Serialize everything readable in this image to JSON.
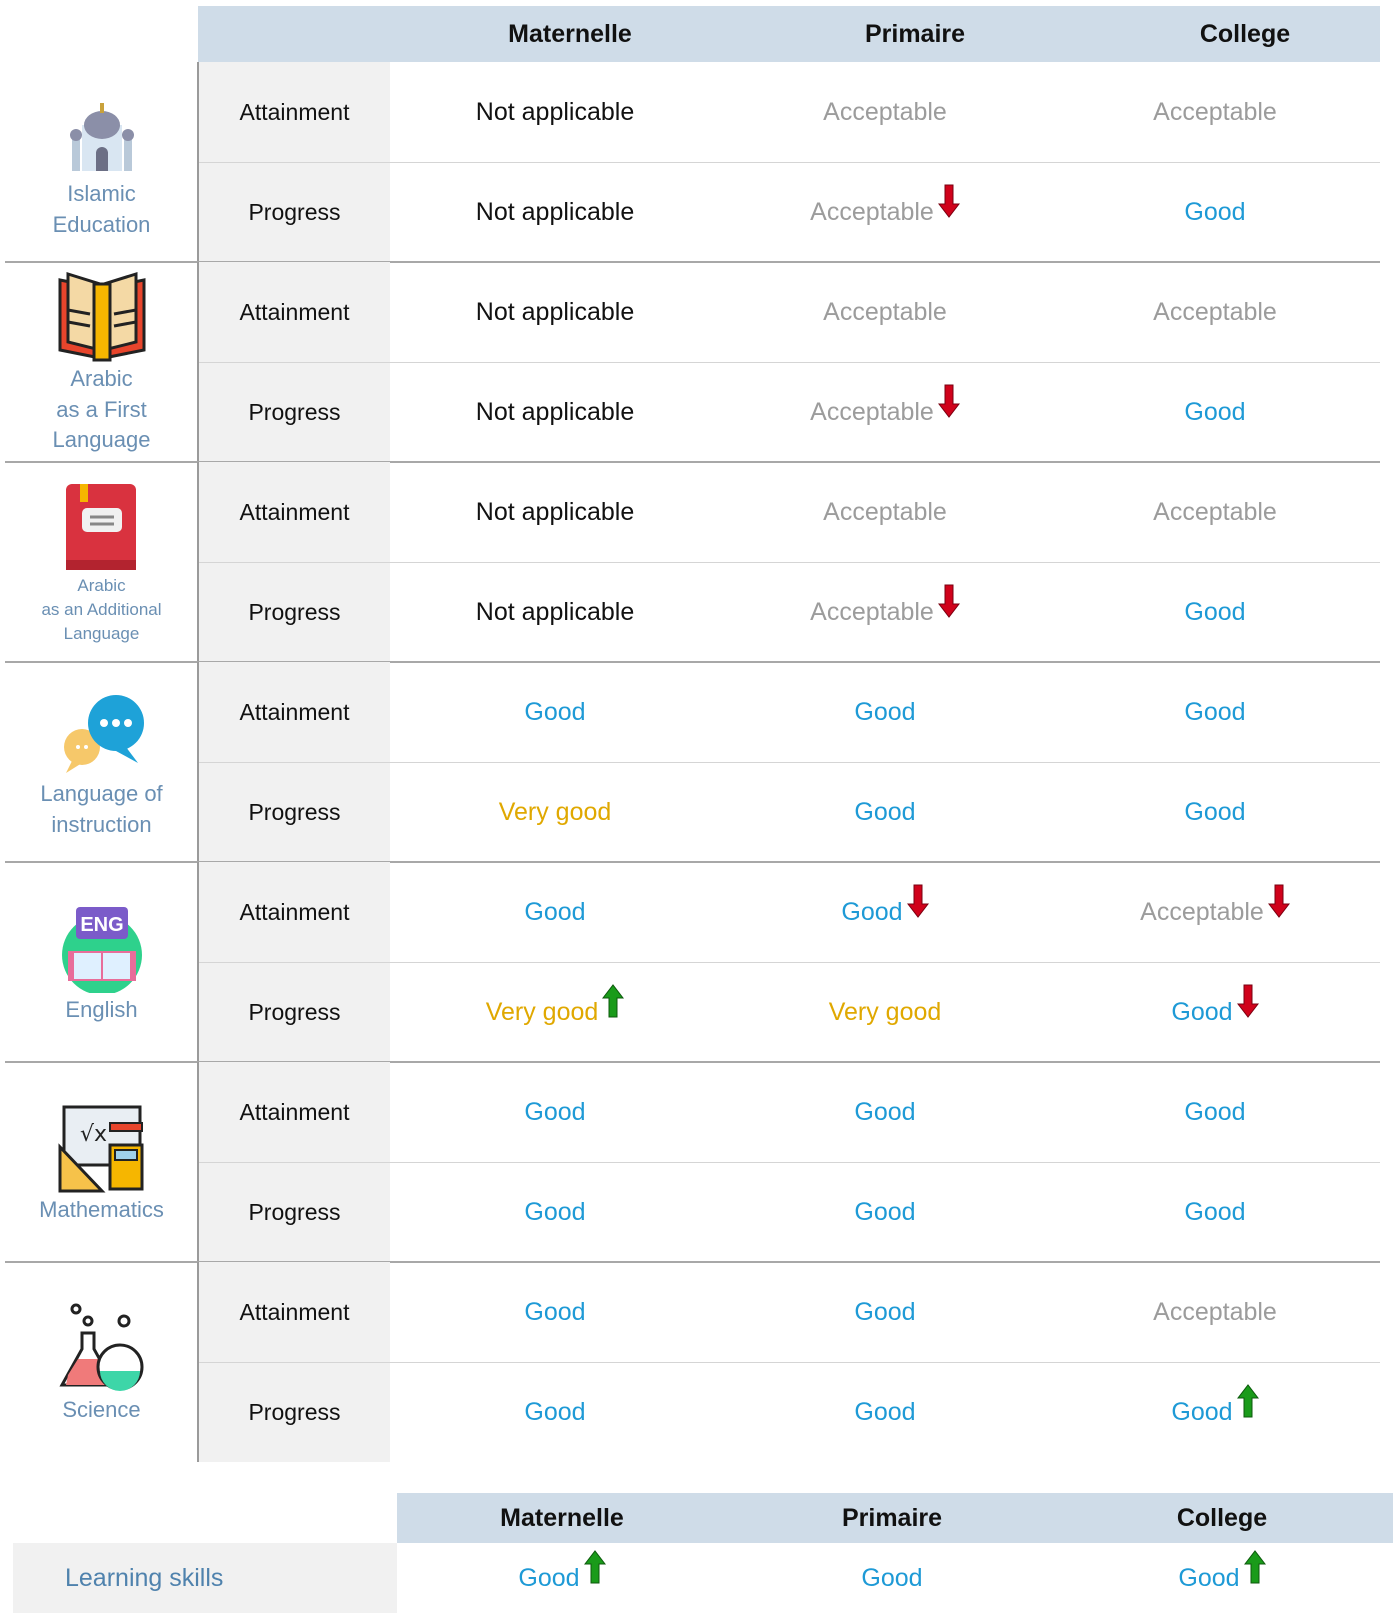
{
  "table1": {
    "headers": [
      "",
      "Maternelle",
      "Primaire",
      "College"
    ],
    "subjects": [
      {
        "name_lines": [
          "Islamic",
          "Education"
        ],
        "icon": "mosque-icon",
        "rows": [
          {
            "type": "Attainment",
            "cells": [
              {
                "text": "Not applicable",
                "status": "na"
              },
              {
                "text": "Acceptable",
                "status": "acc"
              },
              {
                "text": "Acceptable",
                "status": "acc"
              }
            ]
          },
          {
            "type": "Progress",
            "cells": [
              {
                "text": "Not applicable",
                "status": "na"
              },
              {
                "text": "Acceptable",
                "status": "acc",
                "trend": "down"
              },
              {
                "text": "Good",
                "status": "good"
              }
            ]
          }
        ]
      },
      {
        "name_lines": [
          "Arabic",
          "as a First",
          "Language"
        ],
        "icon": "open-book-icon",
        "rows": [
          {
            "type": "Attainment",
            "cells": [
              {
                "text": "Not applicable",
                "status": "na"
              },
              {
                "text": "Acceptable",
                "status": "acc"
              },
              {
                "text": "Acceptable",
                "status": "acc"
              }
            ]
          },
          {
            "type": "Progress",
            "cells": [
              {
                "text": "Not applicable",
                "status": "na"
              },
              {
                "text": "Acceptable",
                "status": "acc",
                "trend": "down"
              },
              {
                "text": "Good",
                "status": "good"
              }
            ]
          }
        ]
      },
      {
        "name_lines": [
          "Arabic",
          "as an Additional",
          "Language"
        ],
        "icon": "closed-book-icon",
        "small": true,
        "rows": [
          {
            "type": "Attainment",
            "cells": [
              {
                "text": "Not applicable",
                "status": "na"
              },
              {
                "text": "Acceptable",
                "status": "acc"
              },
              {
                "text": "Acceptable",
                "status": "acc"
              }
            ]
          },
          {
            "type": "Progress",
            "cells": [
              {
                "text": "Not applicable",
                "status": "na"
              },
              {
                "text": "Acceptable",
                "status": "acc",
                "trend": "down"
              },
              {
                "text": "Good",
                "status": "good"
              }
            ]
          }
        ]
      },
      {
        "name_lines": [
          "Language of",
          "instruction"
        ],
        "icon": "speech-bubbles-icon",
        "rows": [
          {
            "type": "Attainment",
            "cells": [
              {
                "text": "Good",
                "status": "good"
              },
              {
                "text": "Good",
                "status": "good"
              },
              {
                "text": "Good",
                "status": "good"
              }
            ]
          },
          {
            "type": "Progress",
            "cells": [
              {
                "text": "Very good",
                "status": "vg"
              },
              {
                "text": "Good",
                "status": "good"
              },
              {
                "text": "Good",
                "status": "good"
              }
            ]
          }
        ]
      },
      {
        "name_lines": [
          "English"
        ],
        "icon": "english-book-icon",
        "icon_text": "ENG",
        "rows": [
          {
            "type": "Attainment",
            "cells": [
              {
                "text": "Good",
                "status": "good"
              },
              {
                "text": "Good",
                "status": "good",
                "trend": "down"
              },
              {
                "text": "Acceptable",
                "status": "acc",
                "trend": "down"
              }
            ]
          },
          {
            "type": "Progress",
            "cells": [
              {
                "text": "Very good",
                "status": "vg",
                "trend": "up"
              },
              {
                "text": "Very good",
                "status": "vg"
              },
              {
                "text": "Good",
                "status": "good",
                "trend": "down"
              }
            ]
          }
        ]
      },
      {
        "name_lines": [
          "Mathematics"
        ],
        "icon": "math-tools-icon",
        "rows": [
          {
            "type": "Attainment",
            "cells": [
              {
                "text": "Good",
                "status": "good"
              },
              {
                "text": "Good",
                "status": "good"
              },
              {
                "text": "Good",
                "status": "good"
              }
            ]
          },
          {
            "type": "Progress",
            "cells": [
              {
                "text": "Good",
                "status": "good"
              },
              {
                "text": "Good",
                "status": "good"
              },
              {
                "text": "Good",
                "status": "good"
              }
            ]
          }
        ]
      },
      {
        "name_lines": [
          "Science"
        ],
        "icon": "flasks-icon",
        "rows": [
          {
            "type": "Attainment",
            "cells": [
              {
                "text": "Good",
                "status": "good"
              },
              {
                "text": "Good",
                "status": "good"
              },
              {
                "text": "Acceptable",
                "status": "acc"
              }
            ]
          },
          {
            "type": "Progress",
            "cells": [
              {
                "text": "Good",
                "status": "good"
              },
              {
                "text": "Good",
                "status": "good"
              },
              {
                "text": "Good",
                "status": "good",
                "trend": "up"
              }
            ]
          }
        ]
      }
    ]
  },
  "table2": {
    "headers": [
      "",
      "Maternelle",
      "Primaire",
      "College"
    ],
    "rows": [
      {
        "label": "Learning skills",
        "cells": [
          {
            "text": "Good",
            "status": "good",
            "trend": "up"
          },
          {
            "text": "Good",
            "status": "good"
          },
          {
            "text": "Good",
            "status": "good",
            "trend": "up"
          }
        ]
      }
    ]
  },
  "colors": {
    "header_bg": "#cfdce8",
    "good": "#1e9ad6",
    "very_good": "#e0a800",
    "acceptable": "#9c9c9c",
    "arrow_down": "#d0021b",
    "arrow_up": "#1a9b1a"
  }
}
